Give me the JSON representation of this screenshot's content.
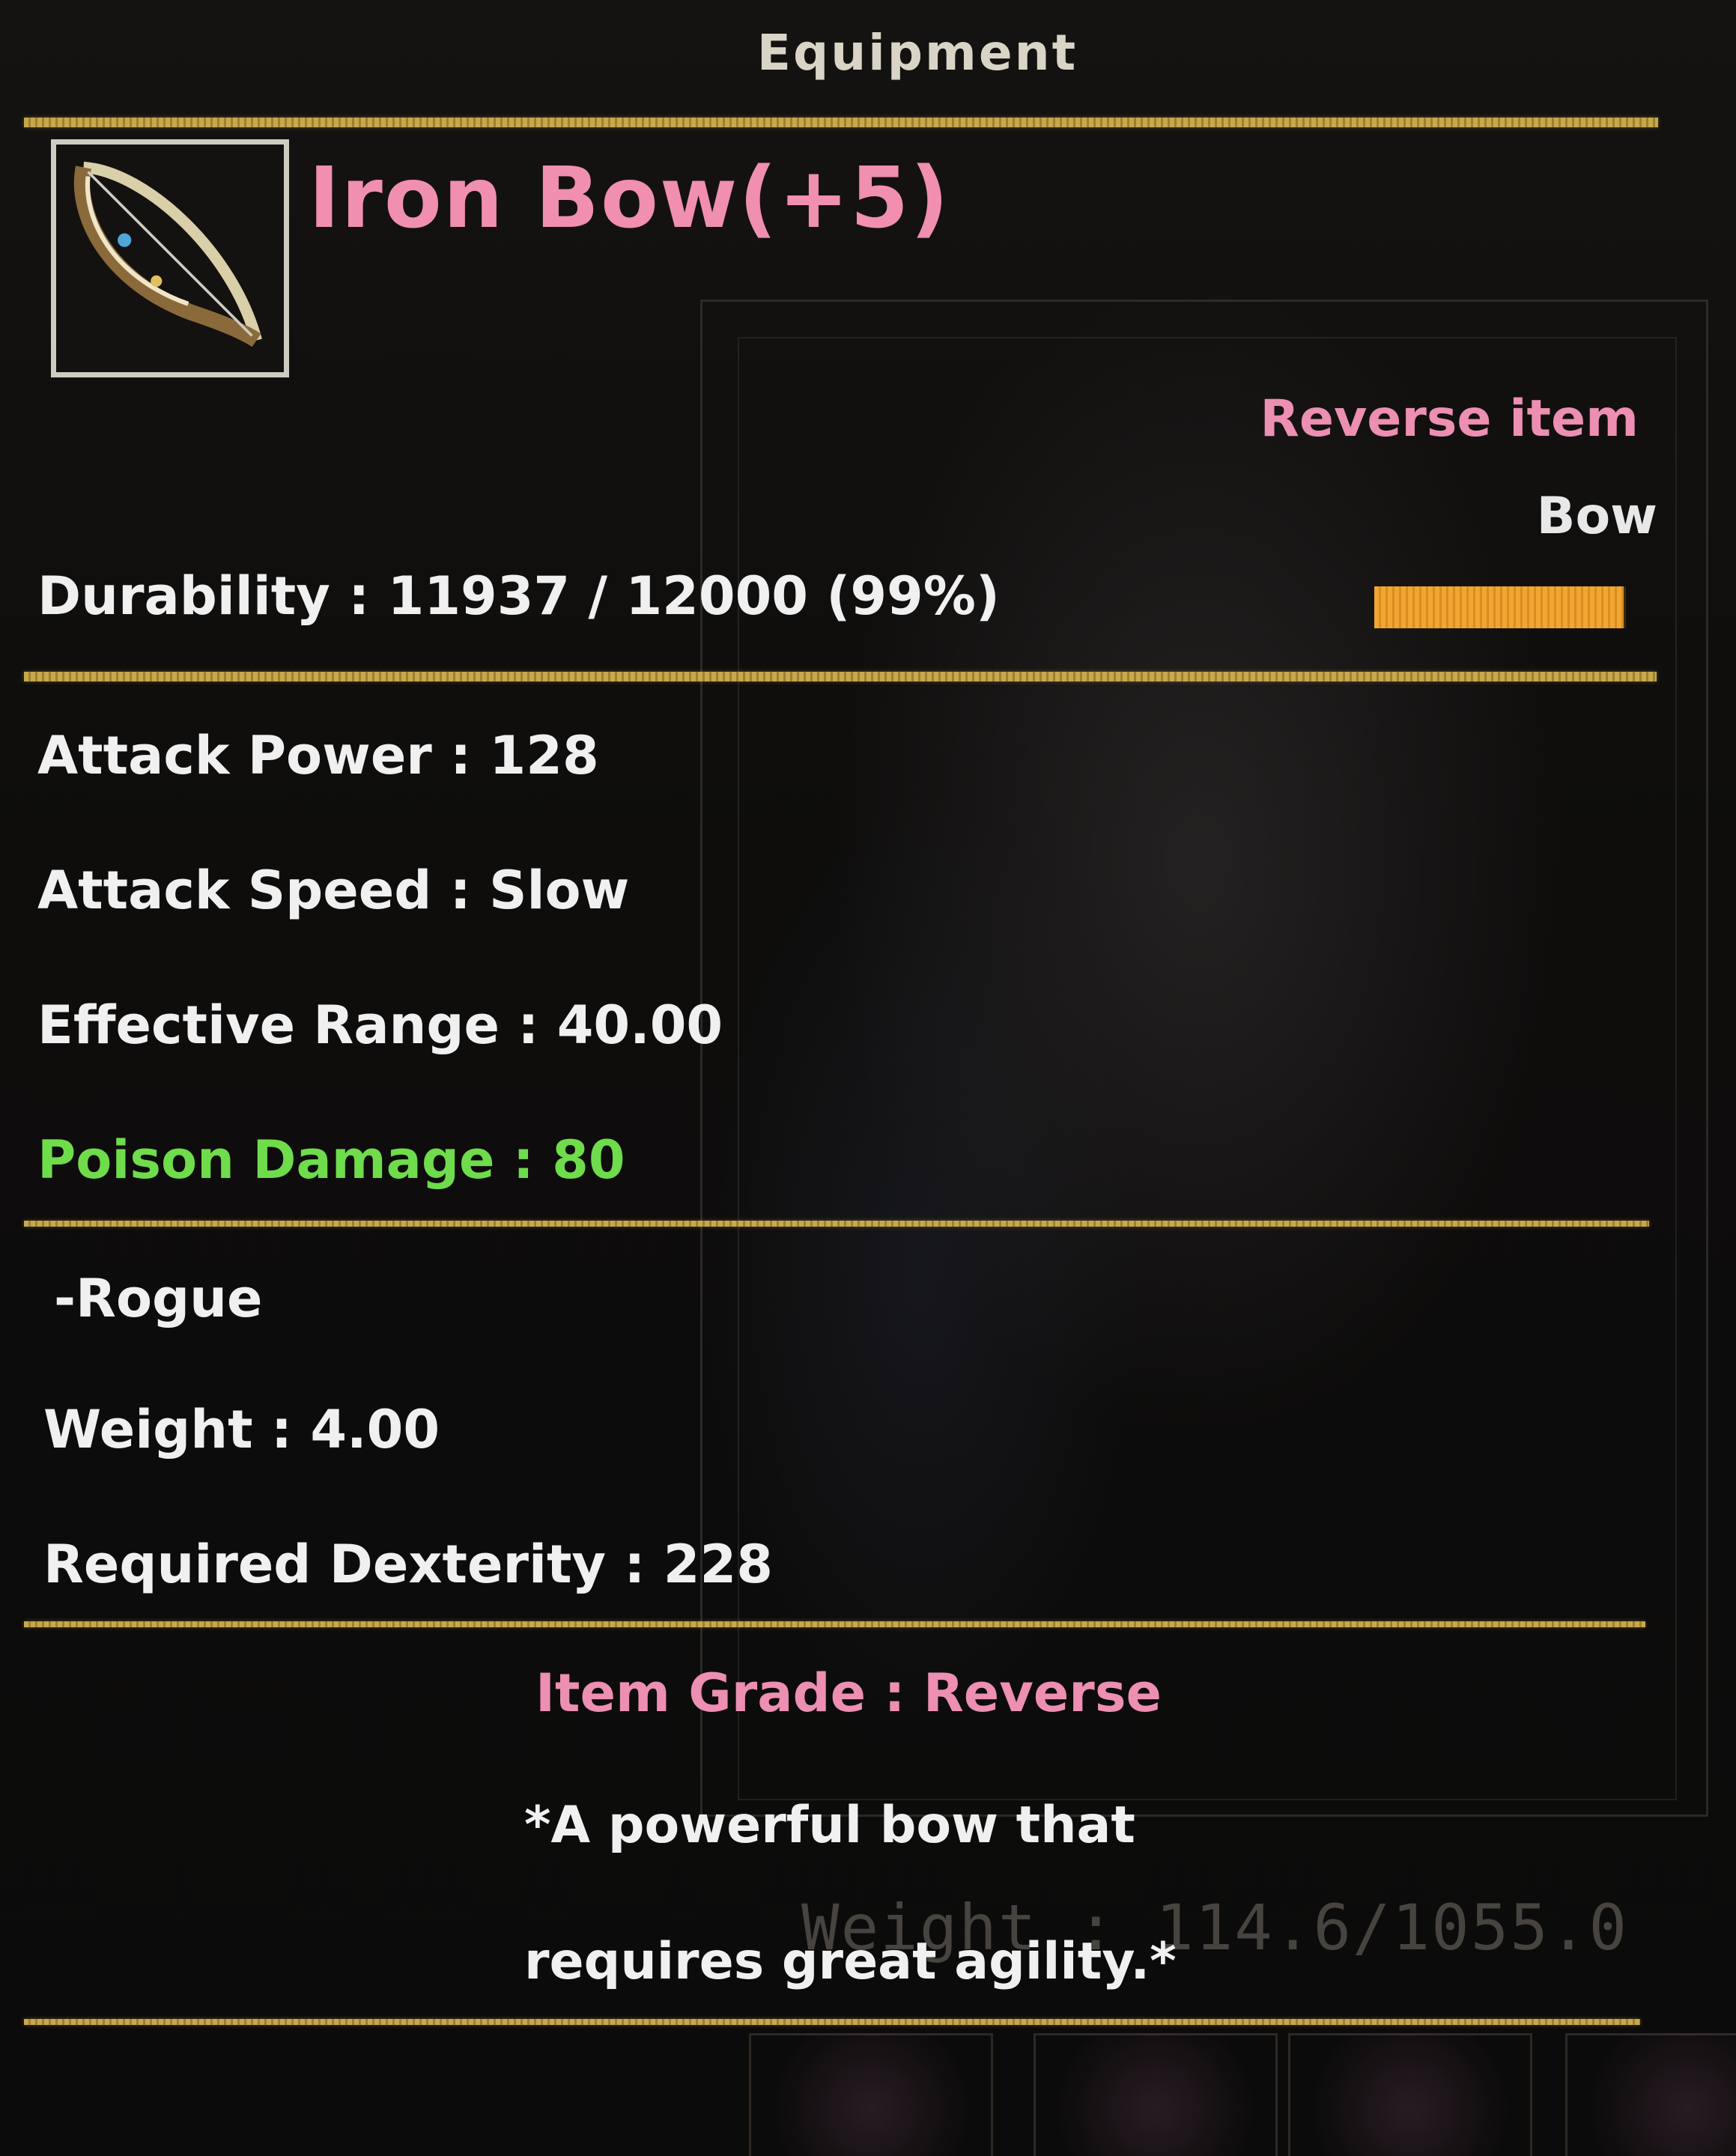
{
  "window": {
    "title": "Equipment"
  },
  "item": {
    "icon": "bow-icon",
    "name": "Iron Bow(+5)",
    "tag": "Reverse item",
    "type": "Bow",
    "durability_text": "Durability : 11937 / 12000 (99%)",
    "durability_fraction": 0.99,
    "stats": {
      "attack_power": "Attack Power : 128",
      "attack_speed": "Attack Speed : Slow",
      "effective_range": "Effective Range : 40.00",
      "poison_damage": "Poison Damage : 80"
    },
    "class_restriction": "-Rogue",
    "weight": "Weight : 4.00",
    "required_dexterity": "Required Dexterity : 228",
    "grade": "Item Grade : Reverse",
    "description_line1": "*A powerful bow that",
    "description_line2": "requires great agility.*"
  },
  "background": {
    "inventory_weight": "Weight : 114.6/1055.0"
  },
  "colors": {
    "accent_gold": "#c8a84a",
    "item_name_pink": "#f08fb0",
    "poison_green": "#6fdc4c",
    "durability_orange": "#f2a632"
  }
}
